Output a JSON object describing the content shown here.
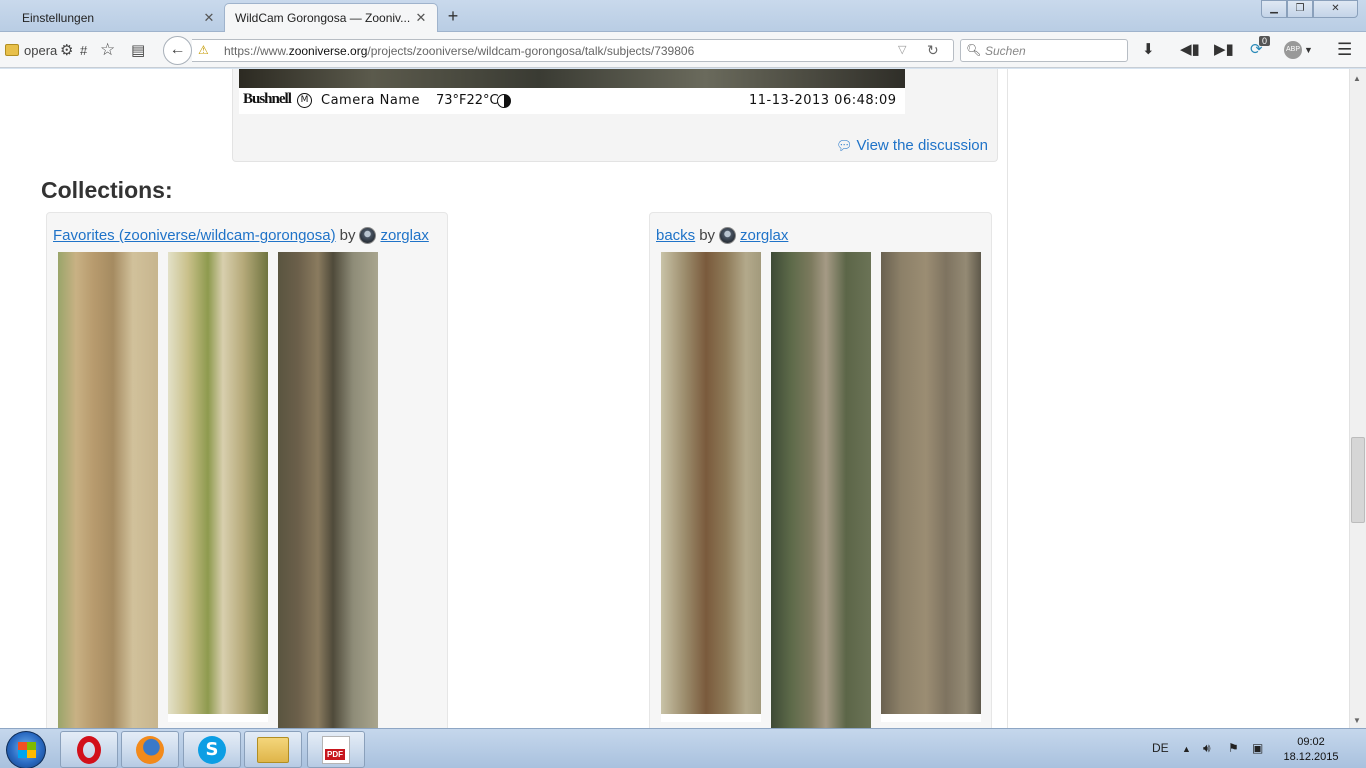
{
  "browser": {
    "tabs": [
      {
        "label": "Einstellungen",
        "close": "✕"
      },
      {
        "label": "WildCam Gorongosa — Zooniv...",
        "close": "✕"
      }
    ],
    "new_tab": "+",
    "window_controls": {
      "minimize": "▁",
      "maximize": "❐",
      "close": "✕"
    },
    "bookmarks": {
      "opera": "opera",
      "hash": "#"
    },
    "url_prefix": "https://www.",
    "url_domain": "zooniverse.org",
    "url_path": "/projects/zooniverse/wildcam-gorongosa/talk/subjects/739806",
    "search_placeholder": "Suchen",
    "notification_count": "0",
    "abp_label": "ABP"
  },
  "subject": {
    "camera_brand": "Bushnell",
    "camera_mode": "M",
    "camera_name": "Camera Name",
    "temperature": "73°F22°C",
    "timestamp": "11-13-2013  06:48:09",
    "view_discussion": "View the discussion"
  },
  "collections": {
    "title": "Collections:",
    "items": [
      {
        "name": "Favorites (zooniverse/wildcam-gorongosa)",
        "by": "by",
        "user": "zorglax"
      },
      {
        "name": "backs",
        "by": "by",
        "user": "zorglax"
      }
    ]
  },
  "taskbar": {
    "language": "DE",
    "time": "09:02",
    "date": "18.12.2015",
    "pdf_label": "PDF"
  },
  "icons": [
    "folder-icon",
    "gear-icon",
    "star-icon",
    "reader-icon",
    "back-icon",
    "warning-icon",
    "reload-icon",
    "search-icon",
    "download-icon",
    "chat-icon",
    "sync-icon",
    "menu-icon",
    "comments-icon",
    "avatar-icon"
  ]
}
